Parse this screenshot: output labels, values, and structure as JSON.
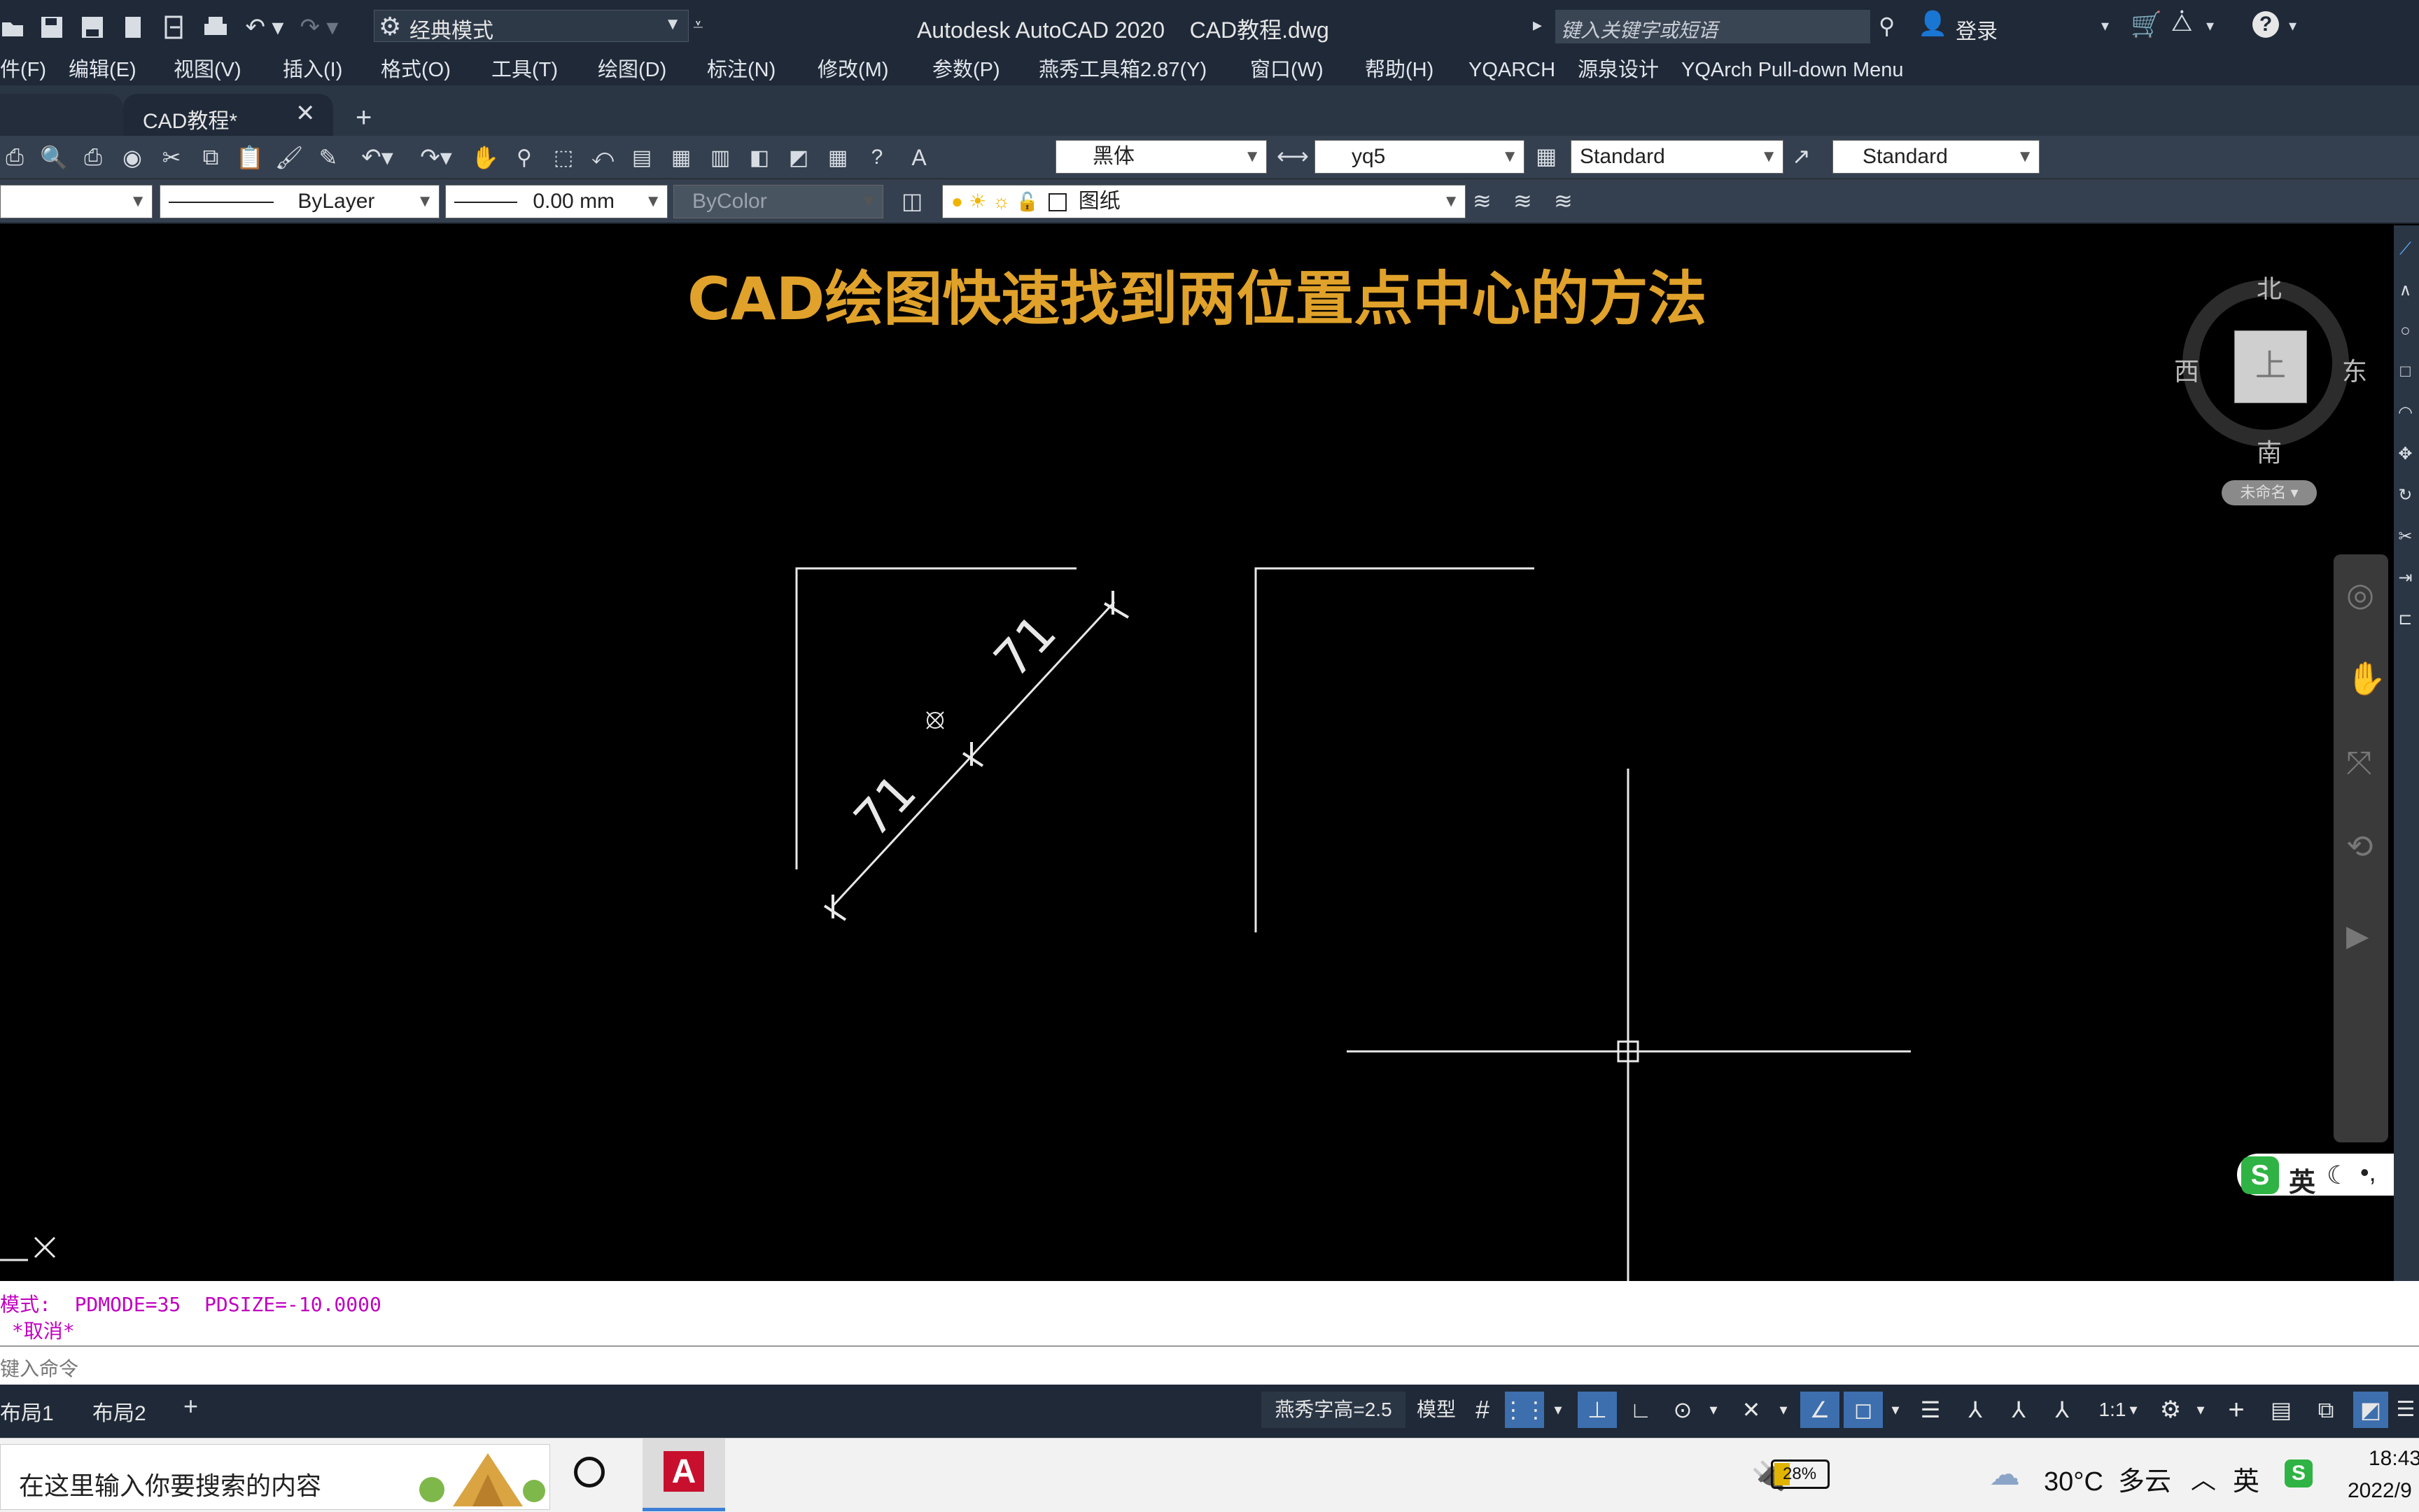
{
  "app": {
    "workspace": "经典模式",
    "title": "Autodesk AutoCAD 2020    CAD教程.dwg",
    "search_placeholder": "键入关键字或短语",
    "login": "登录"
  },
  "menu": [
    "件(F)",
    "编辑(E)",
    "视图(V)",
    "插入(I)",
    "格式(O)",
    "工具(T)",
    "绘图(D)",
    "标注(N)",
    "修改(M)",
    "参数(P)",
    "燕秀工具箱2.87(Y)",
    "窗口(W)",
    "帮助(H)",
    "YQARCH",
    "源泉设计",
    "YQArch Pull-down Menu"
  ],
  "tabs": {
    "active": "CAD教程*"
  },
  "toolbar1": {
    "font": "黑体",
    "dim_style": "yq5",
    "table_style": "Standard",
    "mleader_style": "Standard"
  },
  "toolbar2": {
    "linetype": "ByLayer",
    "lineweight": "0.00 mm",
    "color": "ByColor",
    "layer": "图纸"
  },
  "canvas": {
    "heading": "CAD绘图快速找到两位置点中心的方法",
    "dim_upper": "71",
    "dim_lower": "71"
  },
  "viewcube": {
    "north": "北",
    "south": "南",
    "east": "东",
    "west": "西",
    "face": "上",
    "ucs": "未命名"
  },
  "ime_badge": {
    "lang": "英"
  },
  "command": {
    "line1": "模式:  PDMODE=35  PDSIZE=-10.0000",
    "line2": " *取消*",
    "prompt": "键入命令"
  },
  "layout_tabs": [
    "布局1",
    "布局2"
  ],
  "status": {
    "text_height": "燕秀字高=2.5",
    "space": "模型",
    "scale": "1:1"
  },
  "taskbar": {
    "search": "在这里输入你要搜索的内容",
    "battery": "28%",
    "weather": "30°C  多云",
    "ime": "英",
    "time": "18:43",
    "date": "2022/9"
  },
  "colors": {
    "title_bg": "#1f2938",
    "toolbar_bg": "#34404f",
    "heading": "#e0a22a",
    "command_text": "#c000c0"
  }
}
